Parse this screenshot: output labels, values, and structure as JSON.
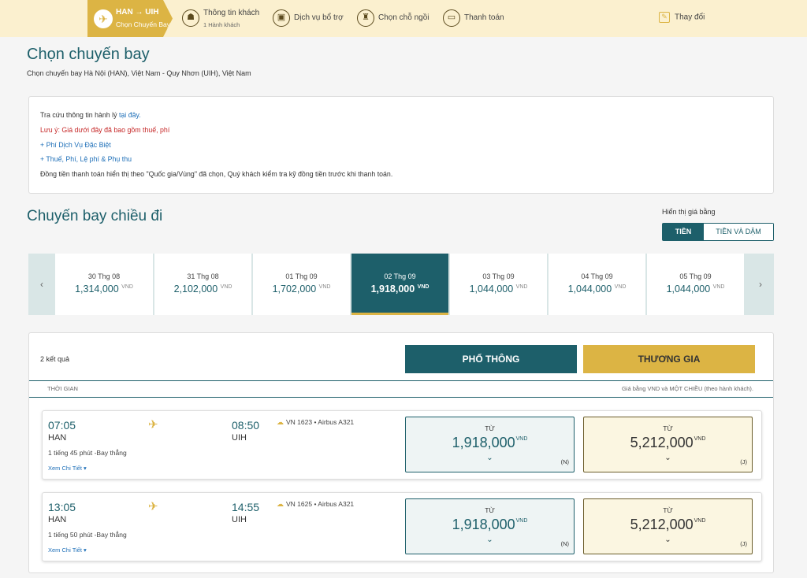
{
  "steps": {
    "route": {
      "title": "HAN → UIH",
      "subtitle": "Chọn Chuyến Bay"
    },
    "passengers": {
      "title": "Thông tin khách",
      "subtitle": "1 Hành khách"
    },
    "extras": {
      "title": "Dịch vụ bổ trợ"
    },
    "seats": {
      "title": "Chọn chỗ ngồi"
    },
    "payment": {
      "title": "Thanh toán"
    },
    "change": {
      "label": "Thay đổi"
    }
  },
  "page": {
    "title": "Chọn chuyến bay",
    "subtitle": "Chọn chuyến bay Hà Nội (HAN), Việt Nam - Quy Nhơn (UIH), Việt Nam"
  },
  "info": {
    "baggage_text": "Tra cứu thông tin hành lý ",
    "baggage_link": "tại đây.",
    "note": "Lưu ý: Giá dưới đây đã bao gồm thuế, phí",
    "special_fees": "+ Phí Dịch Vụ Đặc Biệt",
    "taxes": "+ Thuế, Phí, Lệ phí & Phụ thu",
    "currency_note": "Đồng tiền thanh toán hiển thị theo \"Quốc gia/Vùng\" đã chọn, Quý khách kiểm tra kỹ đồng tiền trước khi thanh toán."
  },
  "outbound": {
    "title": "Chuyến bay chiều đi",
    "show_label": "Hiển thị giá bằng",
    "toggle_money": "TIỀN",
    "toggle_money_miles": "TIỀN VÀ DẶM"
  },
  "dates": [
    {
      "date": "30 Thg 08",
      "price": "1,314,000",
      "cur": "VND"
    },
    {
      "date": "31 Thg 08",
      "price": "2,102,000",
      "cur": "VND"
    },
    {
      "date": "01 Thg 09",
      "price": "1,702,000",
      "cur": "VND"
    },
    {
      "date": "02 Thg 09",
      "price": "1,918,000",
      "cur": "VND"
    },
    {
      "date": "03 Thg 09",
      "price": "1,044,000",
      "cur": "VND"
    },
    {
      "date": "04 Thg 09",
      "price": "1,044,000",
      "cur": "VND"
    },
    {
      "date": "05 Thg 09",
      "price": "1,044,000",
      "cur": "VND"
    }
  ],
  "results": {
    "count": "2 kết quả",
    "economy": "PHỔ THÔNG",
    "business": "THƯƠNG GIA",
    "col_time": "THỜI GIAN",
    "col_note": "Giá bằng VND và MỘT CHIỀU (theo hành khách)."
  },
  "flights": [
    {
      "dep_time": "07:05",
      "dep_airport": "HAN",
      "arr_time": "08:50",
      "arr_airport": "UIH",
      "duration": "1 tiếng 45 phút -Bay thẳng",
      "details": "Xem Chi Tiết ▾",
      "flight_no": "VN 1623 • Airbus A321",
      "from_label": "TỪ",
      "eco_price": "1,918,000",
      "eco_class": "(N)",
      "bus_price": "5,212,000",
      "bus_class": "(J)",
      "currency": "VND"
    },
    {
      "dep_time": "13:05",
      "dep_airport": "HAN",
      "arr_time": "14:55",
      "arr_airport": "UIH",
      "duration": "1 tiếng 50 phút -Bay thẳng",
      "details": "Xem Chi Tiết ▾",
      "flight_no": "VN 1625 • Airbus A321",
      "from_label": "TỪ",
      "eco_price": "1,918,000",
      "eco_class": "(N)",
      "bus_price": "5,212,000",
      "bus_class": "(J)",
      "currency": "VND"
    }
  ],
  "icons": {
    "route": "airplane-icon",
    "passengers": "passenger-icon",
    "extras": "luggage-icon",
    "seats": "seat-icon",
    "payment": "card-icon",
    "change": "edit-icon"
  },
  "colors": {
    "primary": "#1d5f6a",
    "accent": "#dcb444",
    "banner": "#fbf0cf"
  }
}
